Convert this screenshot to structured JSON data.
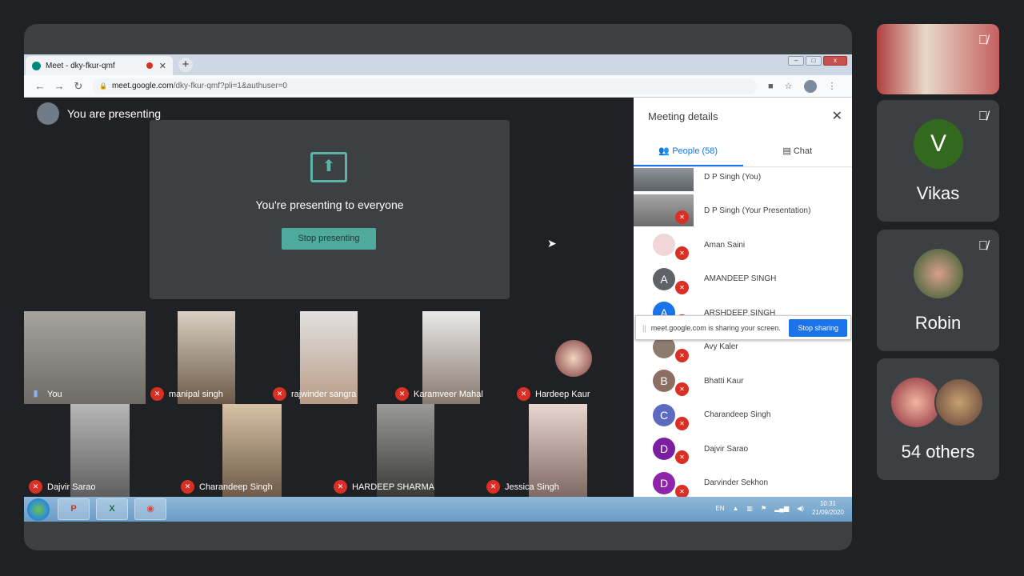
{
  "browser": {
    "tab_title": "Meet - dky-fkur-qmf",
    "tab_close": "✕",
    "new_tab": "+",
    "url_host": "meet.google.com",
    "url_path": "/dky-fkur-qmf?pli=1&authuser=0",
    "back": "←",
    "forward": "→",
    "reload": "↻"
  },
  "presenting": {
    "status": "You are presenting",
    "message": "You're presenting to everyone",
    "stop_label": "Stop presenting"
  },
  "tiles": [
    {
      "name": "You",
      "muted": false
    },
    {
      "name": "manipal singh",
      "muted": true
    },
    {
      "name": "rajwinder sangra",
      "muted": true
    },
    {
      "name": "Karamveer Mahal",
      "muted": true
    },
    {
      "name": "Hardeep Kaur",
      "muted": true
    },
    {
      "name": "Dajvir Sarao",
      "muted": true
    },
    {
      "name": "Charandeep Singh",
      "muted": true
    },
    {
      "name": "HARDEEP SHARMA",
      "muted": true
    },
    {
      "name": "Jessica Singh",
      "muted": true
    }
  ],
  "sidebar": {
    "title": "Meeting details",
    "close": "✕",
    "people_tab": "People (58)",
    "chat_tab": "Chat",
    "people": [
      {
        "name": "D P Singh (You)",
        "initial": ""
      },
      {
        "name": "D P Singh (Your Presentation)",
        "initial": ""
      },
      {
        "name": "Aman Saini",
        "initial": ""
      },
      {
        "name": "AMANDEEP SINGH",
        "initial": "A"
      },
      {
        "name": "ARSHDEEP SINGH",
        "initial": "A"
      },
      {
        "name": "Avy Kaler",
        "initial": ""
      },
      {
        "name": "Bhatti Kaur",
        "initial": "B"
      },
      {
        "name": "Charandeep Singh",
        "initial": "C"
      },
      {
        "name": "Dajvir Sarao",
        "initial": "D"
      },
      {
        "name": "Darvinder Sekhon",
        "initial": "D"
      }
    ]
  },
  "share_notice": {
    "text": "meet.google.com is sharing your screen.",
    "button": "Stop sharing"
  },
  "taskbar": {
    "lang": "EN",
    "time": "10:31",
    "date": "21/09/2020"
  },
  "right_panel": {
    "tiles": [
      {
        "name": "Vikas",
        "initial": "V",
        "color": "#33691e"
      },
      {
        "name": "Robin",
        "initial": "",
        "color": "#7a5a4a"
      },
      {
        "name": "54 others",
        "initial": "",
        "color": "#5d4037"
      }
    ]
  },
  "colors": {
    "accent": "#1a73e8",
    "mic_off": "#d93025",
    "present_teal": "#4fa99c"
  }
}
